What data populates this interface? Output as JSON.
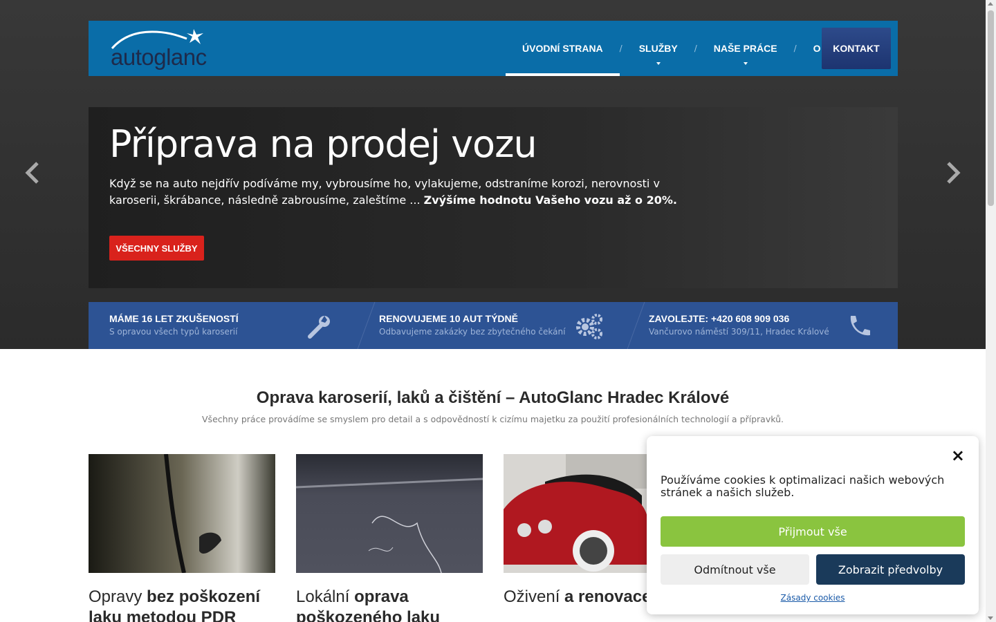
{
  "brand": {
    "logo_text": "autoglanc"
  },
  "nav": {
    "items": [
      {
        "label": "ÚVODNÍ STRANA"
      },
      {
        "label": "SLUŽBY"
      },
      {
        "label": "NAŠE PRÁCE"
      },
      {
        "label": "O NÁS"
      }
    ],
    "separator": "/",
    "contact_label": "KONTAKT"
  },
  "hero": {
    "title": "Příprava na prodej vozu",
    "text": "Když se na auto nejdřív podíváme my, vybrousíme ho, vylakujeme, odstraníme korozi, nerovnosti v karoserii, škrábance, následně zabrousíme, zaleštíme ... ",
    "text_bold": "Zvýšíme hodnotu Vašeho vozu až o 20%.",
    "button_label": "VŠECHNY SLUŽBY"
  },
  "features": [
    {
      "title": "MÁME 16 LET ZKUŠENOSTÍ",
      "subtitle": "S opravou všech typů karoserií",
      "icon": "wrench-icon"
    },
    {
      "title": "RENOVUJEME 10 AUT TÝDNĚ",
      "subtitle": "Odbavujeme zakázky bez zbytečného čekání",
      "icon": "gears-icon"
    },
    {
      "title": "ZAVOLEJTE: +420 608 909 036",
      "subtitle": "Vančurovo náměstí 309/11, Hradec Králové",
      "icon": "phone-icon"
    }
  ],
  "section": {
    "title": "Oprava karoserií, laků a čištění – AutoGlanc Hradec Králové",
    "subtitle": "Všechny práce provádíme se smyslem pro detail a s odpovědností k cizímu majetku za použití profesionálních technologií a přípravků."
  },
  "cards": [
    {
      "pre": "Opravy ",
      "bold": "bez poškození laku metodou PDR"
    },
    {
      "pre": "Lokální ",
      "bold": "oprava poškozeného laku"
    },
    {
      "pre": "Oživení ",
      "bold": "a renovace lak"
    }
  ],
  "cookie": {
    "close": "×",
    "text": "Používáme cookies k optimalizaci našich webových stránek a našich služeb.",
    "accept": "Přijmout vše",
    "deny": "Odmítnout vše",
    "prefs": "Zobrazit předvolby",
    "policy": "Zásady cookies"
  },
  "colors": {
    "header": "#0a6da8",
    "features": "#2d5394",
    "red": "#d9221c",
    "accept": "#8ac43f",
    "prefs": "#1a3a5a"
  }
}
